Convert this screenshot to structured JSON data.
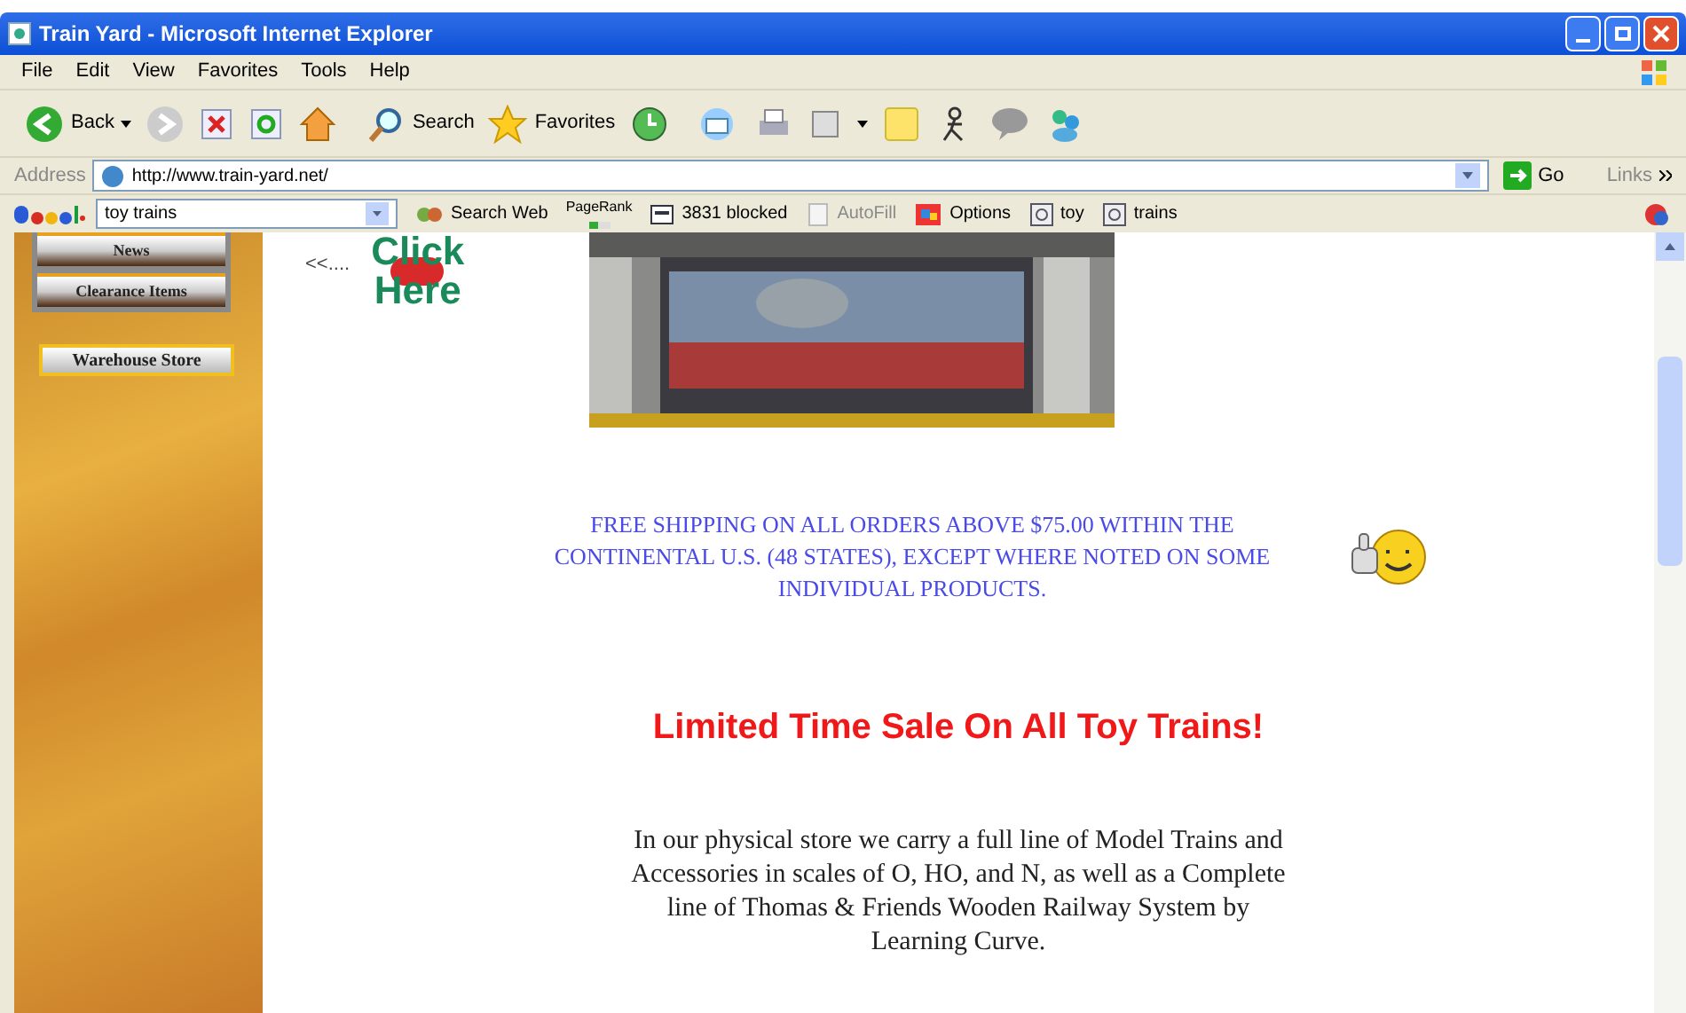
{
  "window": {
    "title": "Train Yard - Microsoft Internet Explorer"
  },
  "menu": [
    "File",
    "Edit",
    "View",
    "Favorites",
    "Tools",
    "Help"
  ],
  "toolbar": {
    "back": "Back",
    "search": "Search",
    "favorites": "Favorites"
  },
  "address_bar": {
    "label": "Address",
    "url": "http://www.train-yard.net/",
    "go": "Go",
    "links": "Links"
  },
  "google_toolbar": {
    "query": "toy trains",
    "items": [
      {
        "kind": "search",
        "label": "Search Web",
        "disabled": false
      },
      {
        "kind": "pagerank",
        "label": "PageRank",
        "disabled": false
      },
      {
        "kind": "blocked",
        "label": "3831 blocked",
        "disabled": false
      },
      {
        "kind": "autofill",
        "label": "AutoFill",
        "disabled": true
      },
      {
        "kind": "options",
        "label": "Options",
        "disabled": false
      },
      {
        "kind": "term",
        "label": "toy",
        "disabled": false
      },
      {
        "kind": "term",
        "label": "trains",
        "disabled": false
      }
    ]
  },
  "sidebar": {
    "buttons": [
      "News",
      "Clearance Items"
    ],
    "warehouse": "Warehouse Store"
  },
  "content": {
    "arrow": "<<....",
    "click_here": [
      "Click",
      "Here"
    ],
    "shipping": "FREE SHIPPING ON ALL ORDERS ABOVE $75.00 WITHIN THE CONTINENTAL U.S. (48 STATES), EXCEPT WHERE NOTED ON SOME INDIVIDUAL PRODUCTS.",
    "sale": "Limited Time Sale On All Toy Trains!",
    "description": "In our physical store we carry a full line of Model Trains and Accessories in scales of O, HO, and N, as well as a Complete line of Thomas & Friends Wooden Railway System by Learning Curve."
  }
}
